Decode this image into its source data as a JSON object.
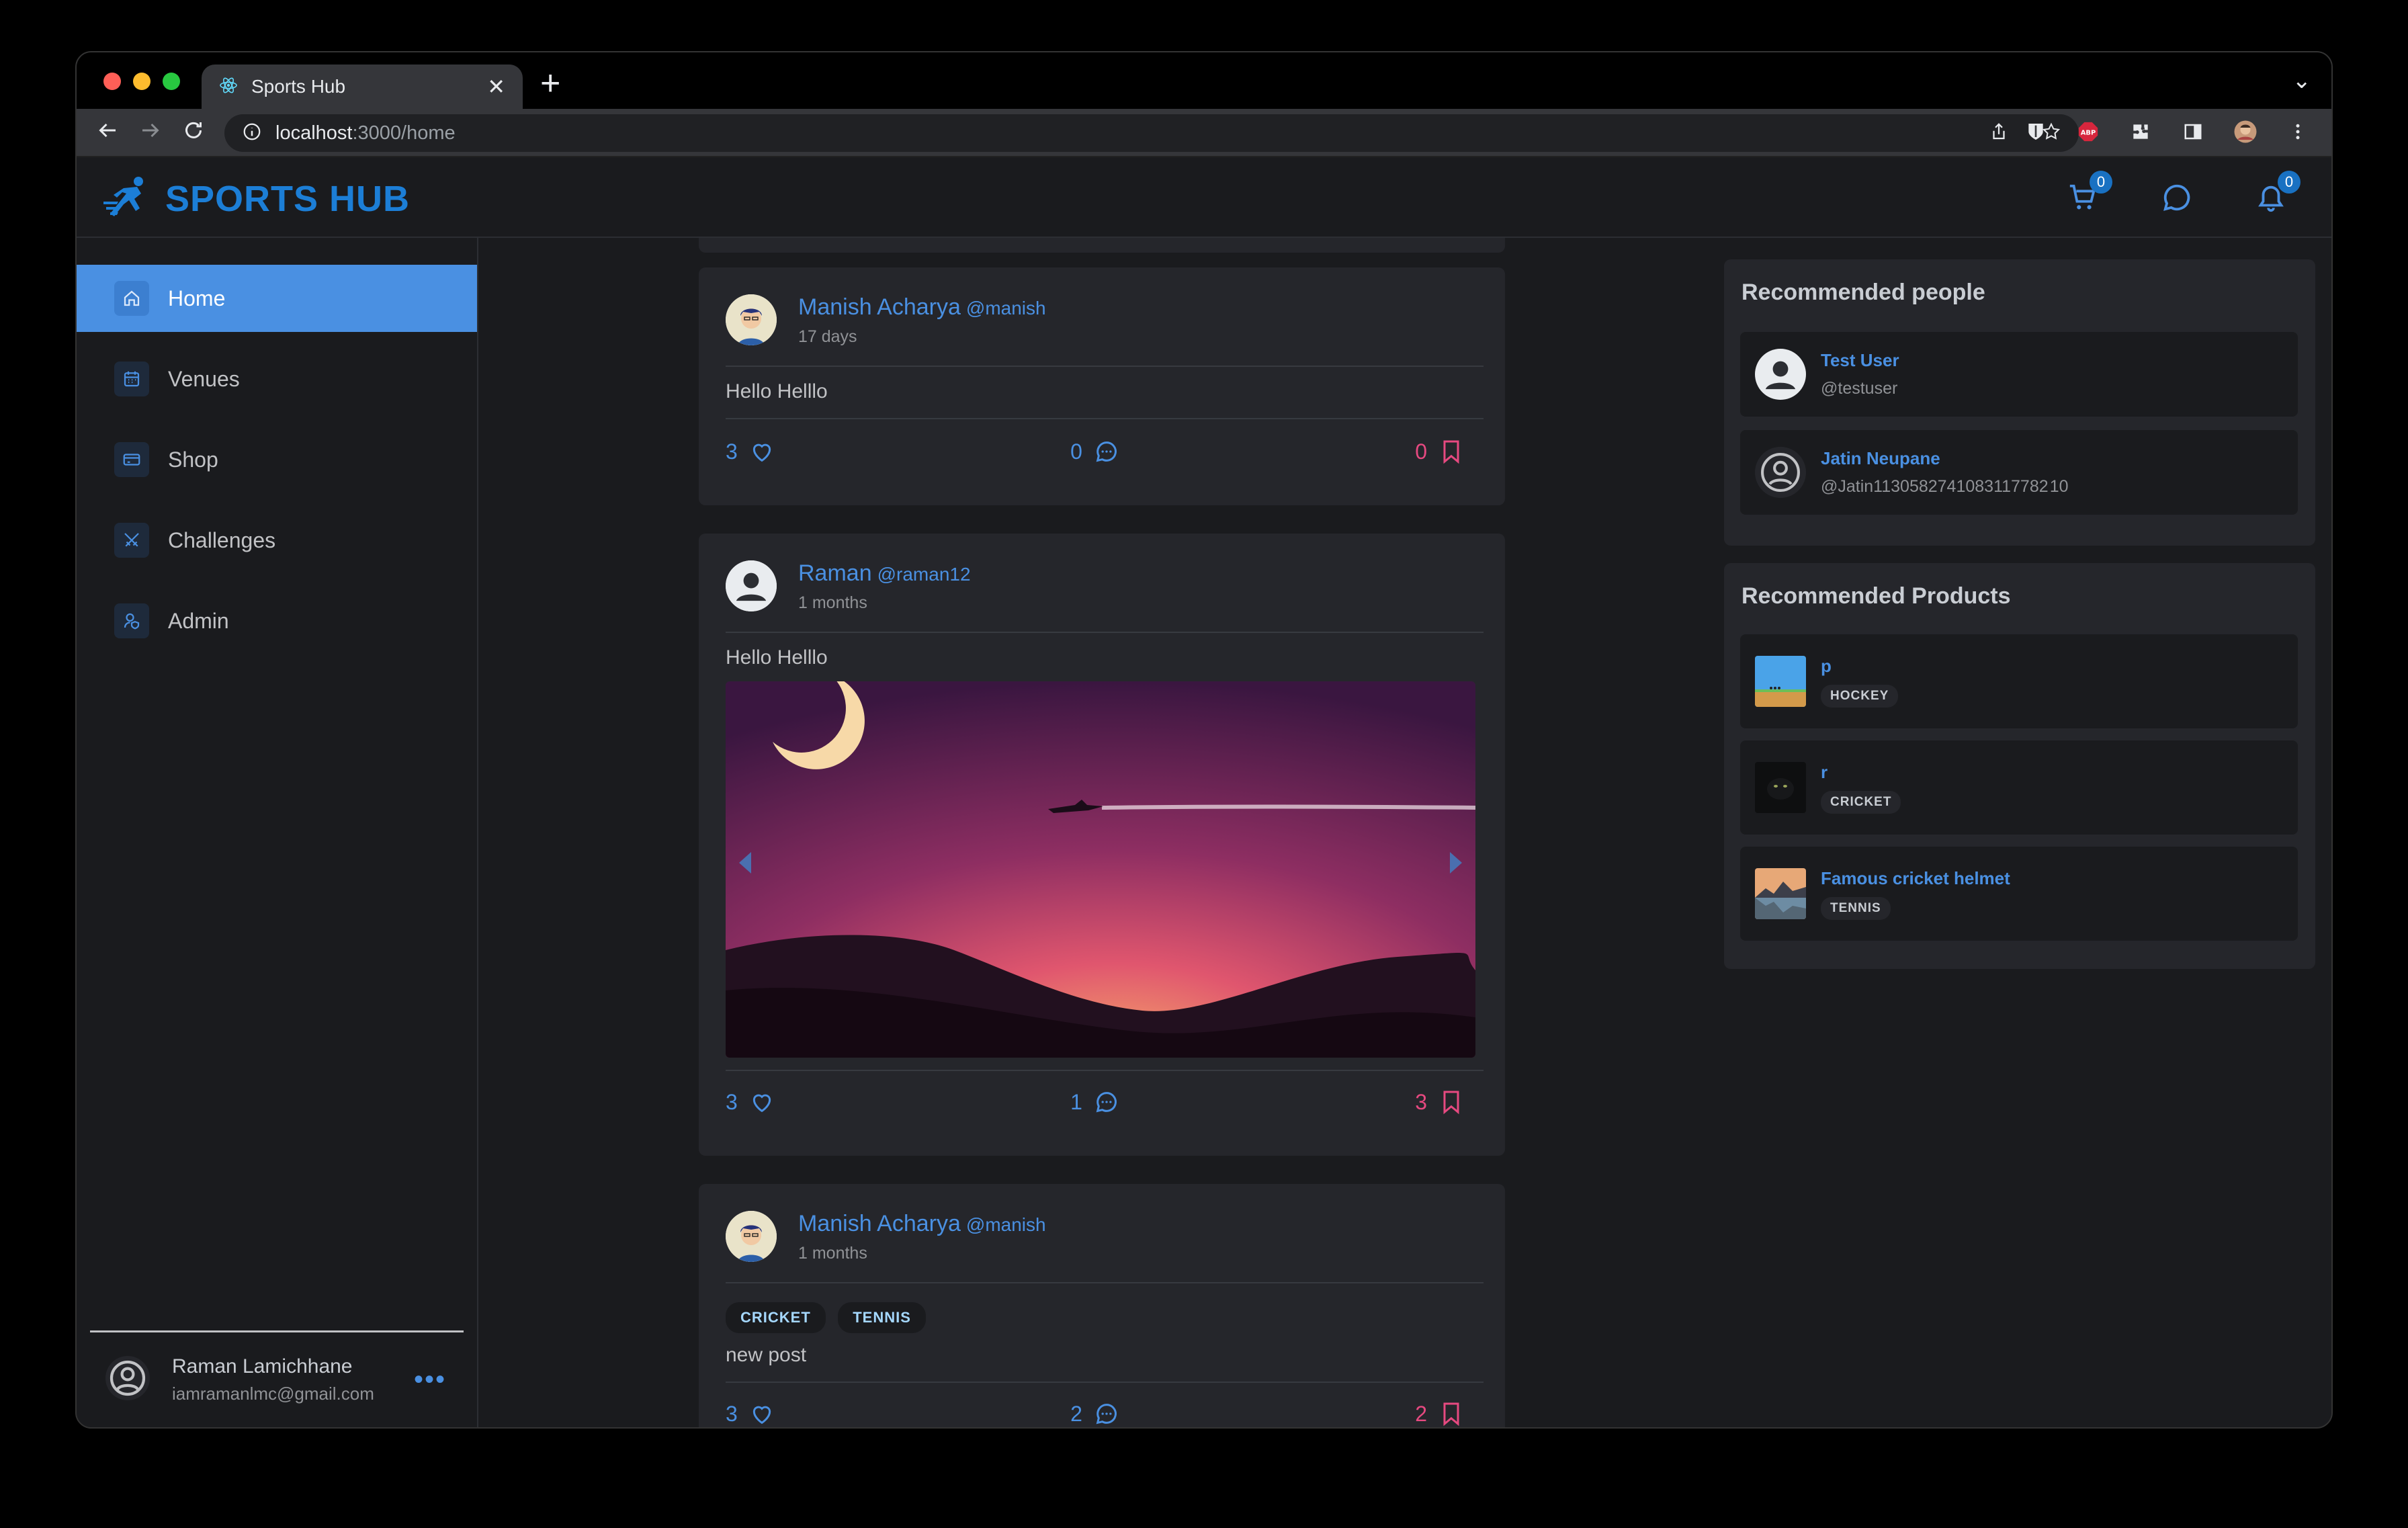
{
  "browser": {
    "tab_title": "Sports Hub",
    "url_host": "localhost",
    "url_path": ":3000/home"
  },
  "app": {
    "brand": "SPORTS HUB",
    "cart_count": "0",
    "notification_count": "0"
  },
  "sidebar": {
    "items": [
      {
        "label": "Home"
      },
      {
        "label": "Venues"
      },
      {
        "label": "Shop"
      },
      {
        "label": "Challenges"
      },
      {
        "label": "Admin"
      }
    ],
    "user": {
      "name": "Raman Lamichhane",
      "email": "iamramanlmc@gmail.com"
    }
  },
  "posts": [
    {
      "author": "Manish Acharya",
      "handle": "@manish",
      "time": "17 days",
      "text": "Hello Helllo",
      "likes": "3",
      "comments": "0",
      "saves": "0"
    },
    {
      "author": "Raman",
      "handle": "@raman12",
      "time": "1 months",
      "text": "Hello Helllo",
      "likes": "3",
      "comments": "1",
      "saves": "3"
    },
    {
      "author": "Manish Acharya",
      "handle": "@manish",
      "time": "1 months",
      "tags": [
        "CRICKET",
        "TENNIS"
      ],
      "text": "new post",
      "likes": "3",
      "comments": "2",
      "saves": "2"
    }
  ],
  "recommended_people": {
    "title": "Recommended people",
    "items": [
      {
        "name": "Test User",
        "handle": "@testuser"
      },
      {
        "name": "Jatin Neupane",
        "handle": "@Jatin1130582741083117782 10"
      }
    ]
  },
  "recommended_products": {
    "title": "Recommended Products",
    "items": [
      {
        "name": "p",
        "tag": "HOCKEY"
      },
      {
        "name": "r",
        "tag": "CRICKET"
      },
      {
        "name": "Famous cricket helmet",
        "tag": "TENNIS"
      }
    ]
  },
  "colors": {
    "accent": "#4a90e2",
    "brand": "#1c7ed6",
    "danger": "#e64980"
  }
}
